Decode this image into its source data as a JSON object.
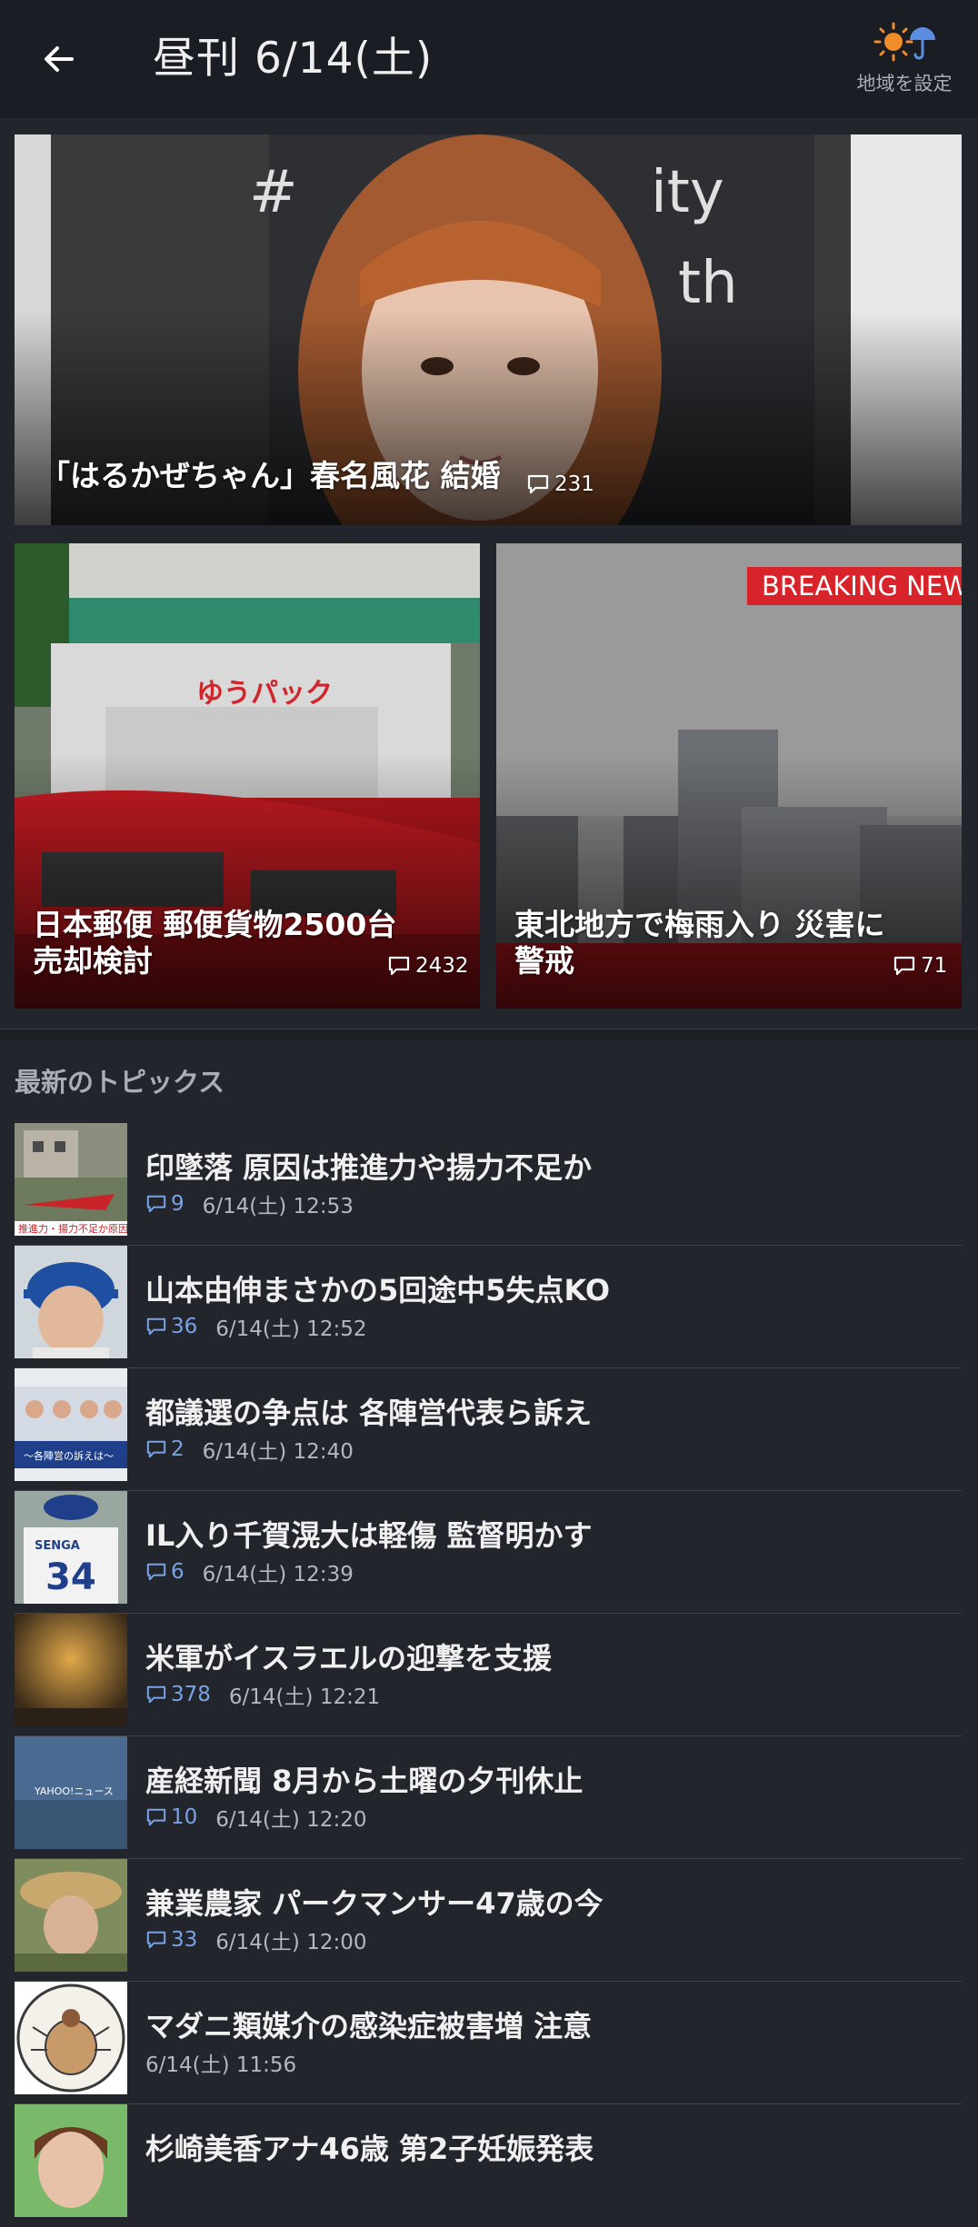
{
  "header": {
    "title": "昼刊 6/14(土)",
    "weather_label": "地域を設定"
  },
  "hero": {
    "title": "「はるかぜちゃん」春名風花 結婚",
    "comments": "231"
  },
  "subs": [
    {
      "title_line1": "日本郵便 郵便貨物2500台",
      "title_line2": "売却検討",
      "comments": "2432"
    },
    {
      "title_line1": "東北地方で梅雨入り 災害に",
      "title_line2": "警戒",
      "comments": "71",
      "banner": "BREAKING NEW"
    }
  ],
  "section_title": "最新のトピックス",
  "topics": [
    {
      "title": "印墜落 原因は推進力や揚力不足か",
      "comments": "9",
      "time": "6/14(土) 12:53"
    },
    {
      "title": "山本由伸まさかの5回途中5失点KO",
      "comments": "36",
      "time": "6/14(土) 12:52"
    },
    {
      "title": "都議選の争点は 各陣営代表ら訴え",
      "comments": "2",
      "time": "6/14(土) 12:40"
    },
    {
      "title": "IL入り千賀滉大は軽傷 監督明かす",
      "comments": "6",
      "time": "6/14(土) 12:39"
    },
    {
      "title": "米軍がイスラエルの迎撃を支援",
      "comments": "378",
      "time": "6/14(土) 12:21"
    },
    {
      "title": "産経新聞 8月から土曜の夕刊休止",
      "comments": "10",
      "time": "6/14(土) 12:20"
    },
    {
      "title": "兼業農家 パークマンサー47歳の今",
      "comments": "33",
      "time": "6/14(土) 12:00"
    },
    {
      "title": "マダニ類媒介の感染症被害増 注意",
      "comments": "",
      "time": "6/14(土) 11:56"
    },
    {
      "title": "杉崎美香アナ46歳 第2子妊娠発表",
      "comments": "",
      "time": ""
    }
  ],
  "thumb_texts": {
    "t1_caption": "推進力・揚力不足か原因か",
    "t3_caption": "～各陣営の訴えは～",
    "t4_jersey_name": "SENGA",
    "t4_jersey_number": "34",
    "t6_logo": "YAHOO!ニュース"
  },
  "colors": {
    "background": "#22252c",
    "header": "#1a1d23",
    "comment_accent": "#7aa3e5"
  }
}
